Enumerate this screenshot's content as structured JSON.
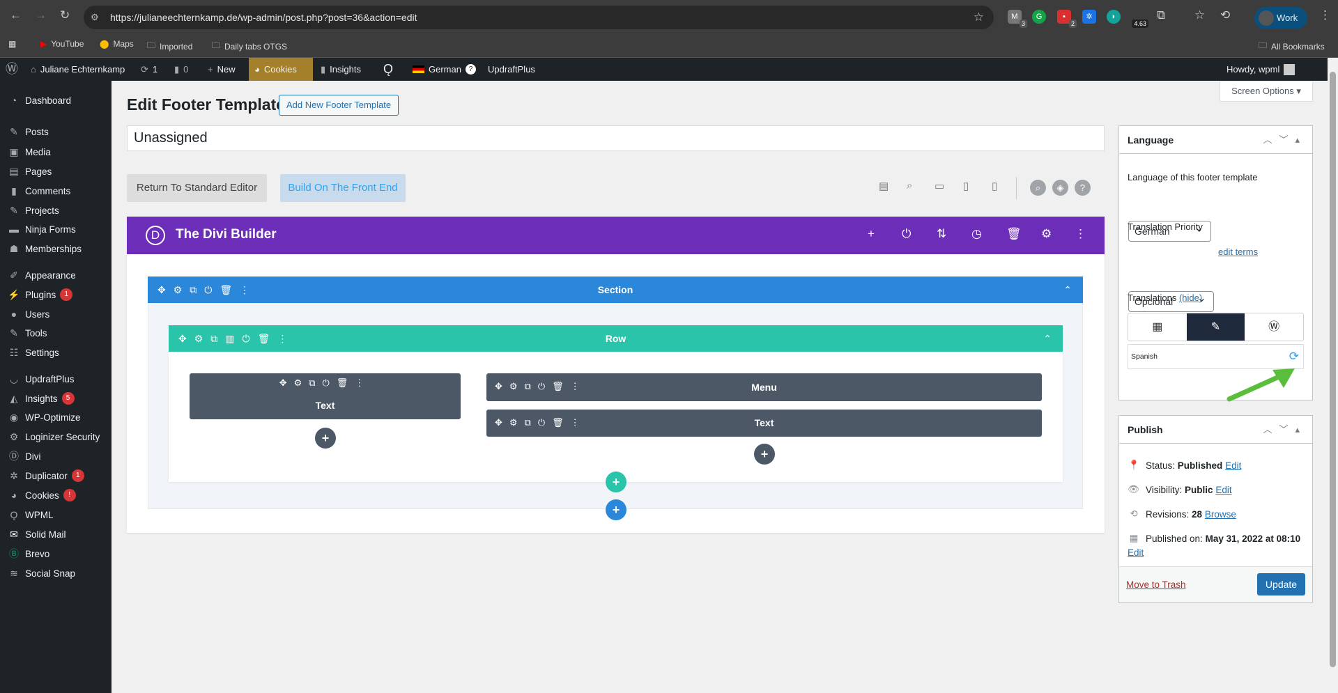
{
  "browser": {
    "url": "https://julianeechternkamp.de/wp-admin/post.php?post=36&action=edit",
    "profile": "Work",
    "extensions": [
      {
        "name": "malwarebytes",
        "badge": "3"
      },
      {
        "name": "grammarly",
        "badge": ""
      },
      {
        "name": "todoist",
        "badge": "2"
      },
      {
        "name": "gear-ext",
        "badge": ""
      },
      {
        "name": "edge-ext",
        "badge": ""
      },
      {
        "name": "meter-ext",
        "badge": "4.63"
      }
    ],
    "bookmarks": [
      "YouTube",
      "Maps",
      "Imported",
      "Daily tabs OTGS"
    ],
    "all_bookmarks": "All Bookmarks"
  },
  "adminbar": {
    "site": "Juliane Echternkamp",
    "updates": "1",
    "comments": "0",
    "new": "New",
    "cookies": "Cookies",
    "insights": "Insights",
    "language": "German",
    "updraft": "UpdraftPlus",
    "howdy": "Howdy, wpml"
  },
  "sidebar": {
    "items": [
      {
        "label": "Dashboard",
        "icon": "dashboard-icon"
      },
      {
        "label": "Posts",
        "icon": "pin-icon"
      },
      {
        "label": "Media",
        "icon": "media-icon"
      },
      {
        "label": "Pages",
        "icon": "pages-icon"
      },
      {
        "label": "Comments",
        "icon": "comment-icon"
      },
      {
        "label": "Projects",
        "icon": "pin-icon"
      },
      {
        "label": "Ninja Forms",
        "icon": "forms-icon"
      },
      {
        "label": "Memberships",
        "icon": "groups-icon"
      },
      {
        "label": "Appearance",
        "icon": "brush-icon"
      },
      {
        "label": "Plugins",
        "icon": "plugin-icon",
        "badge": "1"
      },
      {
        "label": "Users",
        "icon": "user-icon"
      },
      {
        "label": "Tools",
        "icon": "wrench-icon"
      },
      {
        "label": "Settings",
        "icon": "settings-icon"
      },
      {
        "label": "UpdraftPlus",
        "icon": "updraft-icon"
      },
      {
        "label": "Insights",
        "icon": "insights-icon",
        "badge": "5"
      },
      {
        "label": "WP-Optimize",
        "icon": "optimize-icon"
      },
      {
        "label": "Loginizer Security",
        "icon": "gear-icon"
      },
      {
        "label": "Divi",
        "icon": "divi-icon"
      },
      {
        "label": "Duplicator",
        "icon": "duplicator-icon",
        "badge": "1"
      },
      {
        "label": "Cookies",
        "icon": "cookie-icon",
        "badge": "!"
      },
      {
        "label": "WPML",
        "icon": "wpml-icon"
      },
      {
        "label": "Solid Mail",
        "icon": "mail-icon"
      },
      {
        "label": "Brevo",
        "icon": "brevo-icon"
      },
      {
        "label": "Social Snap",
        "icon": "snap-icon"
      }
    ]
  },
  "page": {
    "title": "Edit Footer Template",
    "add_new": "Add New Footer Template",
    "screen_options": "Screen Options",
    "post_title": "Unassigned",
    "return_btn": "Return To Standard Editor",
    "front_btn": "Build On The Front End"
  },
  "builder": {
    "title": "The Divi Builder",
    "section": "Section",
    "row": "Row",
    "col1": [
      {
        "label": "Text"
      }
    ],
    "col2": [
      {
        "label": "Menu"
      },
      {
        "label": "Text"
      }
    ]
  },
  "language_box": {
    "title": "Language",
    "lang_label": "Language of this footer template",
    "lang_value": "German",
    "priority_label": "Translation Priority",
    "priority_value": "Opcional",
    "edit_terms": "edit terms",
    "translations_label": "Translations",
    "hide": "(hide)",
    "translation_lang": "Spanish"
  },
  "publish_box": {
    "title": "Publish",
    "status_label": "Status:",
    "status": "Published",
    "visibility_label": "Visibility:",
    "visibility": "Public",
    "revisions_label": "Revisions:",
    "revisions": "28",
    "browse": "Browse",
    "published_label": "Published on:",
    "published": "May 31, 2022 at 08:10",
    "edit": "Edit",
    "trash": "Move to Trash",
    "update": "Update"
  },
  "colors": {
    "divi_purple": "#6c2eb9",
    "section_blue": "#2b87da",
    "row_teal": "#29c4a9",
    "wp_blue": "#2271b1",
    "arrow_green": "#5bbd3c"
  }
}
